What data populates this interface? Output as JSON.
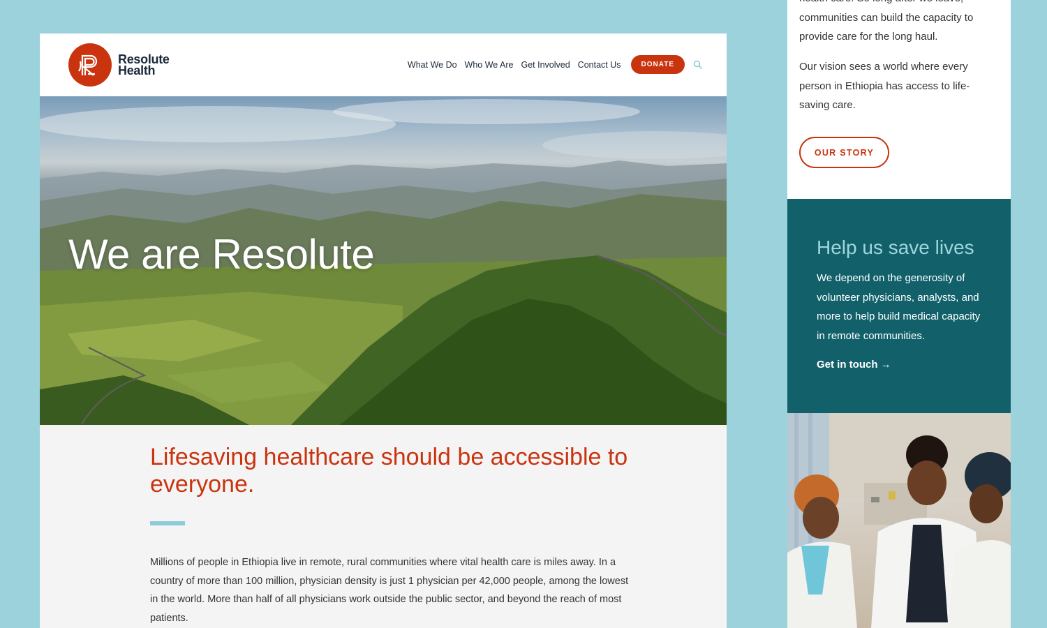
{
  "brand": {
    "name_line1": "Resolute",
    "name_line2": "Health",
    "primary_color": "#c9340f",
    "teal_color": "#12616a",
    "accent_color": "#8ccbd8"
  },
  "nav": {
    "items": [
      "What We Do",
      "Who We Are",
      "Get Involved",
      "Contact Us"
    ],
    "donate_label": "DONATE",
    "search_icon": "search-icon"
  },
  "hero": {
    "title": "We are Resolute"
  },
  "intro": {
    "headline": "Lifesaving healthcare should be accessible to everyone.",
    "body": "Millions of people in Ethiopia live in remote, rural communities where vital health care is miles away. In a country of more than 100 million, physician density is  just 1 physician per 42,000 people, among the lowest in the world. More than half of all physicians work outside the public sector, and beyond the reach of most patients."
  },
  "mobile": {
    "text1": "health care. So long after we leave, communities can build the capacity to provide care for the long haul.",
    "text2": "Our vision sees a world where every person in Ethiopia has access to life-saving care.",
    "our_story_label": "OUR STORY",
    "help": {
      "title": "Help us save lives",
      "body": "We depend on the generosity of volunteer physicians, analysts, and more to help build medical capacity in remote communities.",
      "link_label": "Get in touch →"
    }
  }
}
